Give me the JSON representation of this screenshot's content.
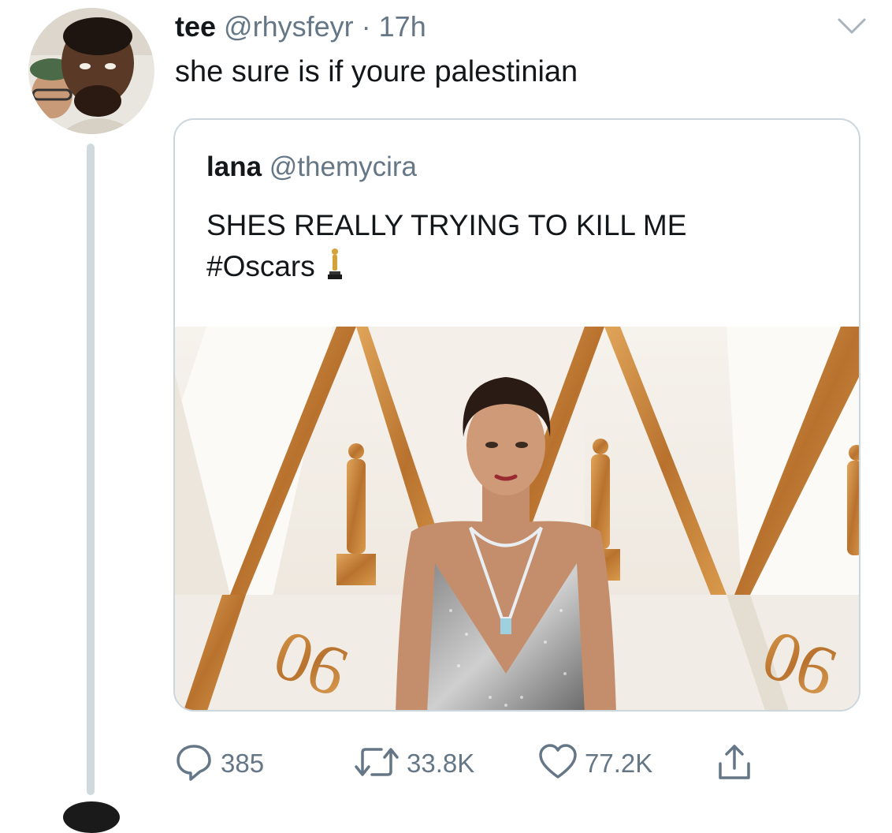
{
  "tweet": {
    "author_name": "tee",
    "author_handle": "@rhysfeyr",
    "separator": "·",
    "time": "17h",
    "text": "she sure is if youre palestinian"
  },
  "quoted_tweet": {
    "author_name": "lana",
    "author_handle": "@themycira",
    "text_line1": "SHES REALLY TRYING TO KILL ME",
    "text_line2": "#Oscars",
    "emoji": "oscar-trophy-icon"
  },
  "actions": {
    "replies": "385",
    "retweets": "33.8K",
    "likes": "77.2K"
  },
  "colors": {
    "secondary_text": "#657786",
    "thread_line": "#cfd9de",
    "card_border": "#ccd6dd",
    "gold": "#c8893a"
  },
  "icons": [
    "reply-icon",
    "retweet-icon",
    "like-icon",
    "share-icon",
    "chevron-down-icon"
  ]
}
